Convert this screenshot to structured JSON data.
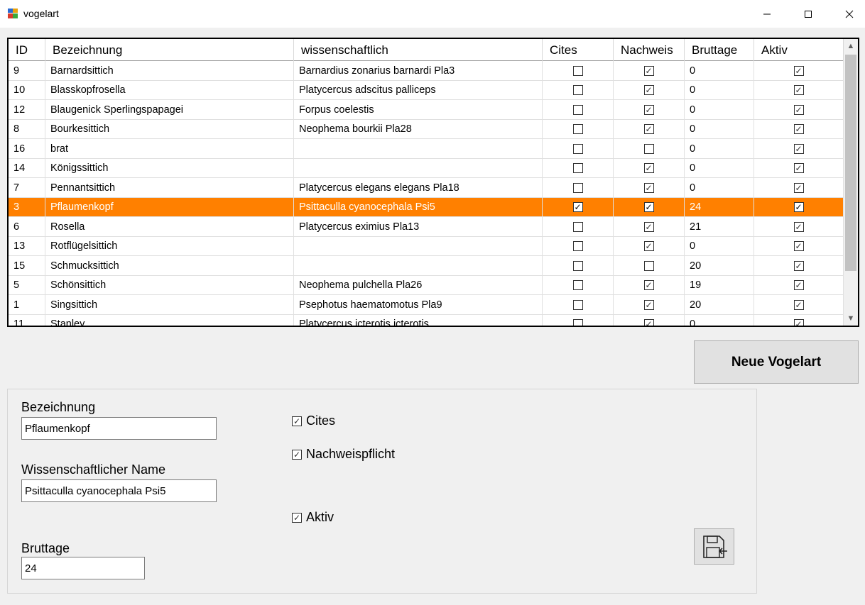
{
  "window": {
    "title": "vogelart"
  },
  "grid": {
    "columns": [
      "ID",
      "Bezeichnung",
      "wissenschaftlich",
      "Cites",
      "Nachweis",
      "Bruttage",
      "Aktiv"
    ],
    "rows": [
      {
        "id": "9",
        "bez": "Barnardsittich",
        "wiss": "Barnardius zonarius barnardi Pla3",
        "cites": false,
        "nachweis": true,
        "bruttage": "0",
        "aktiv": true
      },
      {
        "id": "10",
        "bez": "Blasskopfrosella",
        "wiss": "Platycercus adscitus palliceps",
        "cites": false,
        "nachweis": true,
        "bruttage": "0",
        "aktiv": true
      },
      {
        "id": "12",
        "bez": "Blaugenick Sperlingspapagei",
        "wiss": "Forpus coelestis",
        "cites": false,
        "nachweis": true,
        "bruttage": "0",
        "aktiv": true
      },
      {
        "id": "8",
        "bez": "Bourkesittich",
        "wiss": "Neophema bourkii Pla28",
        "cites": false,
        "nachweis": true,
        "bruttage": "0",
        "aktiv": true
      },
      {
        "id": "16",
        "bez": "brat",
        "wiss": "",
        "cites": false,
        "nachweis": false,
        "bruttage": "0",
        "aktiv": true
      },
      {
        "id": "14",
        "bez": "Königssittich",
        "wiss": "",
        "cites": false,
        "nachweis": true,
        "bruttage": "0",
        "aktiv": true
      },
      {
        "id": "7",
        "bez": "Pennantsittich",
        "wiss": "Platycercus elegans elegans Pla18",
        "cites": false,
        "nachweis": true,
        "bruttage": "0",
        "aktiv": true
      },
      {
        "id": "3",
        "bez": "Pflaumenkopf",
        "wiss": "Psittaculla cyanocephala Psi5",
        "cites": true,
        "nachweis": true,
        "bruttage": "24",
        "aktiv": true,
        "selected": true
      },
      {
        "id": "6",
        "bez": "Rosella",
        "wiss": "Platycercus eximius Pla13",
        "cites": false,
        "nachweis": true,
        "bruttage": "21",
        "aktiv": true
      },
      {
        "id": "13",
        "bez": "Rotflügelsittich",
        "wiss": "",
        "cites": false,
        "nachweis": true,
        "bruttage": "0",
        "aktiv": true
      },
      {
        "id": "15",
        "bez": "Schmucksittich",
        "wiss": "",
        "cites": false,
        "nachweis": false,
        "bruttage": "20",
        "aktiv": true
      },
      {
        "id": "5",
        "bez": "Schönsittich",
        "wiss": "Neophema pulchella Pla26",
        "cites": false,
        "nachweis": true,
        "bruttage": "19",
        "aktiv": true
      },
      {
        "id": "1",
        "bez": "Singsittich",
        "wiss": "Psephotus haematomotus Pla9",
        "cites": false,
        "nachweis": true,
        "bruttage": "20",
        "aktiv": true
      },
      {
        "id": "11",
        "bez": "Stanley",
        "wiss": "Platycercus icterotis icterotis",
        "cites": false,
        "nachweis": true,
        "bruttage": "0",
        "aktiv": true
      }
    ],
    "selected_color": "#ff8000"
  },
  "buttons": {
    "neue_vogelart": "Neue Vogelart"
  },
  "form": {
    "bezeichnung_label": "Bezeichnung",
    "bezeichnung_value": "Pflaumenkopf",
    "wiss_label": "Wissenschaftlicher Name",
    "wiss_value": "Psittaculla cyanocephala Psi5",
    "bruttage_label": "Bruttage",
    "bruttage_value": "24",
    "cites_label": "Cites",
    "cites_checked": true,
    "nachweis_label": "Nachweispflicht",
    "nachweis_checked": true,
    "aktiv_label": "Aktiv",
    "aktiv_checked": true
  }
}
